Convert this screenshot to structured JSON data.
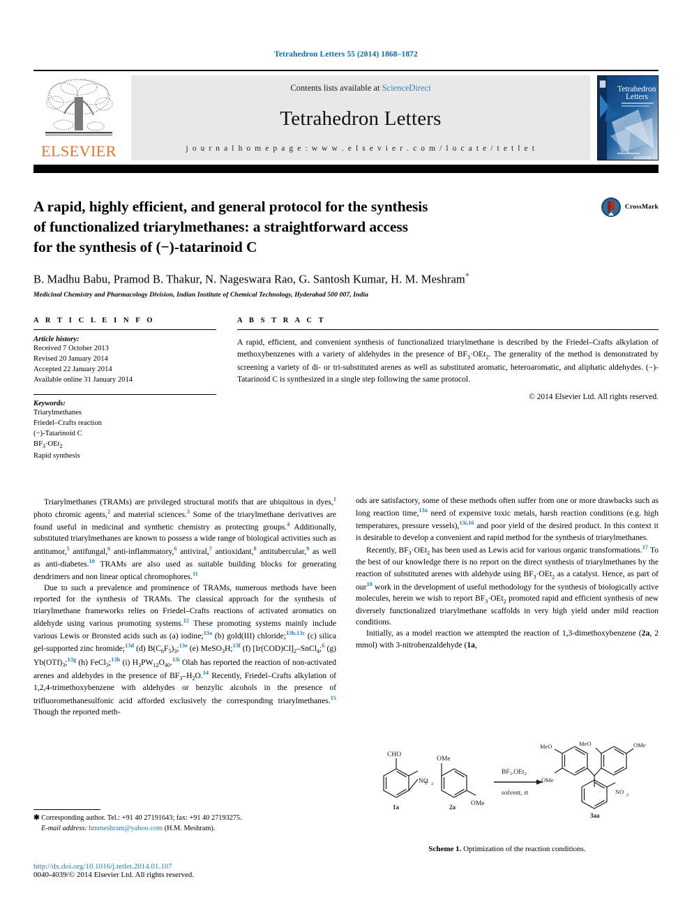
{
  "running_head": "Tetrahedron Letters 55 (2014) 1868–1872",
  "masthead": {
    "contents_prefix": "Contents lists available at ",
    "sciencedirect": "ScienceDirect",
    "journal_title": "Tetrahedron Letters",
    "homepage": "j o u r n a l   h o m e p a g e :   w w w . e l s e v i e r . c o m / l o c a t e / t e t l e t",
    "publisher": "ELSEVIER",
    "cover_title_line1": "Tetrahedron",
    "cover_title_line2": "Letters",
    "accent_blue": "#2e87c4",
    "elsevier_orange": "#E9711C"
  },
  "article": {
    "title_line1": "A rapid, highly efficient, and general protocol for the synthesis",
    "title_line2": "of functionalized triarylmethanes: a straightforward access",
    "title_line3": "for the synthesis of (−)-tatarinoid C",
    "crossmark_label": "CrossMark",
    "authors": "B. Madhu Babu, Pramod B. Thakur, N. Nageswara Rao, G. Santosh Kumar, H. M. Meshram",
    "author_marker": "*",
    "affiliation": "Medicinal Chemistry and Pharmacology Division, Indian Institute of Chemical Technology, Hyderabad 500 007, India"
  },
  "info": {
    "heading": "A R T I C L E   I N F O",
    "history_label": "Article history:",
    "history": [
      "Received 7 October 2013",
      "Revised 20 January 2014",
      "Accepted 22 January 2014",
      "Available online 31 January 2014"
    ],
    "keywords_label": "Keywords:",
    "keywords": [
      "Triarylmethanes",
      "Friedel–Crafts reaction",
      "(−)-Tatarinoid C",
      "BF3·OEt2",
      "Rapid synthesis"
    ]
  },
  "abstract": {
    "heading": "A B S T R A C T",
    "text": "A rapid, efficient, and convenient synthesis of functionalized triarylmethane is described by the Friedel–Crafts alkylation of methoxybenzenes with a variety of aldehydes in the presence of BF3·OEt2. The generality of the method is demonstrated by screening a variety of di- or tri-substituted arenes as well as substituted aromatic, heteroaromatic, and aliphatic aldehydes. (−)-Tatarinoid C is synthesized in a single step following the same protocol.",
    "copyright": "© 2014 Elsevier Ltd. All rights reserved."
  },
  "body": {
    "left_paragraphs": [
      "Triarylmethanes (TRAMs) are privileged structural motifs that are ubiquitous in dyes,1 photo chromic agents,2 and material sciences.3 Some of the triarylmethane derivatives are found useful in medicinal and synthetic chemistry as protecting groups.4 Additionally, substituted triarylmethanes are known to possess a wide range of biological activities such as antitumor,5 antifungal,6 anti-inflammatory,6 antiviral,7 antioxidant,8 antitubercular,9 as well as anti-diabetes.10 TRAMs are also used as suitable building blocks for generating dendrimers and non linear optical chromophores.11",
      "Due to such a prevalence and prominence of TRAMs, numerous methods have been reported for the synthesis of TRAMs. The classical approach for the synthesis of triarylmethane frameworks relies on Friedel–Crafts reactions of activated aromatics on aldehyde using various promoting systems.12 These promoting systems mainly include various Lewis or Bronsted acids such as (a) iodine;13a (b) gold(III) chloride;13b,13c (c) silica gel-supported zinc bromide;13d (d) B(C6F5)3;13e (e) MeSO3H;13f (f) [Ir(COD)Cl]2–SnCl4;6 (g) Yb(OTf)3;13g (h) FeCl3;13h (i) H3PW12O40.13i Olah has reported the reaction of non-activated arenes and aldehydes in the presence of BF3–H2O.14 Recently, Friedel–Crafts alkylation of 1,2,4-trimethoxybenzene with aldehydes or benzylic alcohols in the presence of trifluoromethanesulfonic acid afforded exclusively the corresponding triarylmethanes.15 Though the reported meth-"
    ],
    "right_paragraphs": [
      "ods are satisfactory, some of these methods often suffer from one or more drawbacks such as long reaction time,13a need of expensive toxic metals, harsh reaction conditions (e.g. high temperatures, pressure vessels),13i,16 and poor yield of the desired product. In this context it is desirable to develop a convenient and rapid method for the synthesis of triarylmethanes.",
      "Recently, BF3·OEt2 has been used as Lewis acid for various organic transformations.17 To the best of our knowledge there is no report on the direct synthesis of triarylmethanes by the reaction of substituted arenes with aldehyde using BF3·OEt2 as a catalyst. Hence, as part of our18 work in the development of useful methodology for the synthesis of biologically active molecules, herein we wish to report BF3·OEt2 promoted rapid and efficient synthesis of new diversely functionalized triarylmethane scaffolds in very high yield under mild reaction conditions.",
      "Initially, as a model reaction we attempted the reaction of 1,3-dimethoxybenzene (2a, 2 mmol) with 3-nitrobenzaldehyde (1a,"
    ]
  },
  "footnote": {
    "corresponding": "Corresponding author. Tel.: +91 40 27191643; fax: +91 40 27193275.",
    "email_label": "E-mail address:",
    "email": "hmmeshram@yahoo.com",
    "email_suffix": "(H.M. Meshram).",
    "doi": "http://dx.doi.org/10.1016/j.tetlet.2014.01.107",
    "issn": "0040-4039/© 2014 Elsevier Ltd. All rights reserved."
  },
  "scheme": {
    "caption_bold": "Scheme 1.",
    "caption_rest": " Optimization of the reaction conditions.",
    "reagent_top": "BF3.OEt2",
    "reagent_bottom": "solvent, rt",
    "plus": "+",
    "labels": {
      "reactant1": "1a",
      "reactant2": "2a",
      "product": "3aa",
      "cho": "CHO",
      "no2": "NO2",
      "ome": "OMe",
      "meo": "MeO"
    }
  }
}
